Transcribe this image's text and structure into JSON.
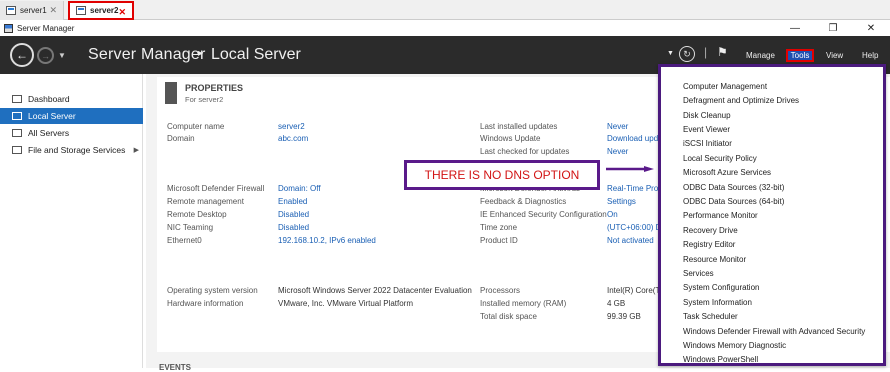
{
  "tabs": [
    {
      "label": "server1",
      "close": "✕"
    },
    {
      "label": "server2",
      "close": "✕"
    }
  ],
  "window": {
    "title": "Server Manager",
    "minimize": "—",
    "restore": "❐",
    "close": "✕"
  },
  "header": {
    "app": "Server Manager",
    "separator": "▸",
    "page": "Local Server",
    "manage": "Manage",
    "tools": "Tools",
    "view": "View",
    "help": "Help"
  },
  "sidebar": {
    "items": [
      {
        "label": "Dashboard"
      },
      {
        "label": "Local Server"
      },
      {
        "label": "All Servers"
      },
      {
        "label": "File and Storage Services"
      }
    ]
  },
  "properties": {
    "title": "PROPERTIES",
    "subtitle": "For server2",
    "left": [
      {
        "k": "Computer name",
        "v": "server2"
      },
      {
        "k": "Domain",
        "v": "abc.com"
      },
      {
        "k": "Microsoft Defender Firewall",
        "v": "Domain: Off"
      },
      {
        "k": "Remote management",
        "v": "Enabled"
      },
      {
        "k": "Remote Desktop",
        "v": "Disabled"
      },
      {
        "k": "NIC Teaming",
        "v": "Disabled"
      },
      {
        "k": "Ethernet0",
        "v": "192.168.10.2, IPv6 enabled"
      },
      {
        "k": "Operating system version",
        "v": "Microsoft Windows Server 2022 Datacenter Evaluation"
      },
      {
        "k": "Hardware information",
        "v": "VMware, Inc. VMware Virtual Platform"
      }
    ],
    "right": [
      {
        "k": "Last installed updates",
        "v": "Never"
      },
      {
        "k": "Windows Update",
        "v": "Download upd"
      },
      {
        "k": "Last checked for updates",
        "v": "Never"
      },
      {
        "k": "Microsoft Defender Antivirus",
        "v": "Real-Time Prot"
      },
      {
        "k": "Feedback & Diagnostics",
        "v": "Settings"
      },
      {
        "k": "IE Enhanced Security Configuration",
        "v": "On"
      },
      {
        "k": "Time zone",
        "v": "(UTC+06:00) D"
      },
      {
        "k": "Product ID",
        "v": "Not activated"
      },
      {
        "k": "Processors",
        "v": "Intel(R) Core(T"
      },
      {
        "k": "Installed memory (RAM)",
        "v": "4 GB"
      },
      {
        "k": "Total disk space",
        "v": "99.39 GB"
      }
    ]
  },
  "events_label": "EVENTS",
  "annotation": "THERE IS NO DNS OPTION",
  "tools_menu": [
    "Computer Management",
    "Defragment and Optimize Drives",
    "Disk Cleanup",
    "Event Viewer",
    "iSCSI Initiator",
    "Local Security Policy",
    "Microsoft Azure Services",
    "ODBC Data Sources (32-bit)",
    "ODBC Data Sources (64-bit)",
    "Performance Monitor",
    "Recovery Drive",
    "Registry Editor",
    "Resource Monitor",
    "Services",
    "System Configuration",
    "System Information",
    "Task Scheduler",
    "Windows Defender Firewall with Advanced Security",
    "Windows Memory Diagnostic",
    "Windows PowerShell"
  ],
  "colors": {
    "header_bg": "#2b2b2b",
    "accent": "#1f6fbf",
    "highlight_red": "#e00000",
    "annotation_border": "#5a1a8a"
  }
}
